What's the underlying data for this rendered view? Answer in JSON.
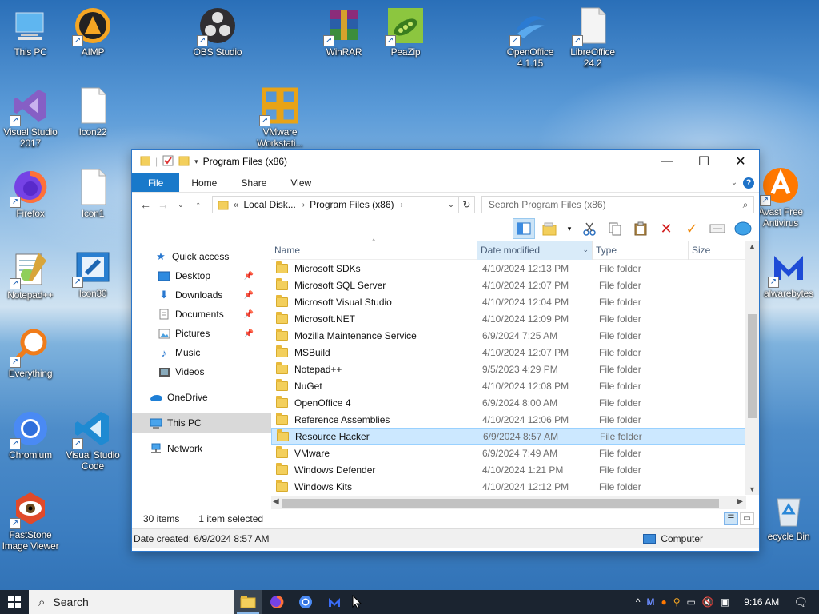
{
  "desktop": {
    "icons": [
      {
        "id": "this-pc",
        "label": "This PC"
      },
      {
        "id": "aimp",
        "label": "AIMP"
      },
      {
        "id": "obs",
        "label": "OBS Studio"
      },
      {
        "id": "winrar",
        "label": "WinRAR"
      },
      {
        "id": "peazip",
        "label": "PeaZip"
      },
      {
        "id": "openoffice",
        "label": "OpenOffice 4.1.15"
      },
      {
        "id": "libreoffice",
        "label": "LibreOffice 24.2"
      },
      {
        "id": "visualstudio",
        "label": "Visual Studio 2017"
      },
      {
        "id": "icon22",
        "label": "Icon22"
      },
      {
        "id": "vmware",
        "label": "VMware Workstati..."
      },
      {
        "id": "firefox",
        "label": "Firefox"
      },
      {
        "id": "icon1",
        "label": "Icon1"
      },
      {
        "id": "avast",
        "label": "Avast Free Antivirus"
      },
      {
        "id": "notepadpp",
        "label": "Notepad++"
      },
      {
        "id": "icon30",
        "label": "Icon30"
      },
      {
        "id": "malwarebytes",
        "label": "alwarebytes"
      },
      {
        "id": "everything",
        "label": "Everything"
      },
      {
        "id": "chromium",
        "label": "Chromium"
      },
      {
        "id": "vscode",
        "label": "Visual Studio Code"
      },
      {
        "id": "faststone",
        "label": "FastStone Image Viewer"
      },
      {
        "id": "recycle",
        "label": "ecycle Bin"
      }
    ]
  },
  "window": {
    "title": "Program Files (x86)",
    "minimize": "—",
    "maximize": "☐",
    "close": "✕"
  },
  "ribbon": {
    "tabs": [
      "File",
      "Home",
      "Share",
      "View"
    ],
    "expand": "⌄",
    "help": "?"
  },
  "address": {
    "back": "←",
    "forward": "→",
    "recent": "⌄",
    "up": "↑",
    "prefix": "«",
    "segments": [
      "Local Disk...",
      "Program Files (x86)"
    ],
    "chevron": "›",
    "dropdown": "⌄",
    "refresh": "↻"
  },
  "search": {
    "placeholder": "Search Program Files (x86)"
  },
  "nav": {
    "items": [
      {
        "label": "Quick access",
        "icon": "star-icon",
        "pinned": false
      },
      {
        "label": "Desktop",
        "icon": "desktop-icon",
        "pinned": true
      },
      {
        "label": "Downloads",
        "icon": "download-icon",
        "pinned": true
      },
      {
        "label": "Documents",
        "icon": "document-icon",
        "pinned": true
      },
      {
        "label": "Pictures",
        "icon": "picture-icon",
        "pinned": true
      },
      {
        "label": "Music",
        "icon": "music-icon",
        "pinned": false
      },
      {
        "label": "Videos",
        "icon": "video-icon",
        "pinned": false
      },
      {
        "label": "OneDrive",
        "icon": "cloud-icon",
        "pinned": false
      },
      {
        "label": "This PC",
        "icon": "computer-icon",
        "pinned": false
      },
      {
        "label": "Network",
        "icon": "network-icon",
        "pinned": false
      }
    ]
  },
  "columns": {
    "name": "Name",
    "date": "Date modified",
    "type": "Type",
    "size": "Size",
    "date_sort": "⌄"
  },
  "files": [
    {
      "name": "Microsoft SDKs",
      "date": "4/10/2024 12:13 PM",
      "type": "File folder"
    },
    {
      "name": "Microsoft SQL Server",
      "date": "4/10/2024 12:07 PM",
      "type": "File folder"
    },
    {
      "name": "Microsoft Visual Studio",
      "date": "4/10/2024 12:04 PM",
      "type": "File folder"
    },
    {
      "name": "Microsoft.NET",
      "date": "4/10/2024 12:09 PM",
      "type": "File folder"
    },
    {
      "name": "Mozilla Maintenance Service",
      "date": "6/9/2024 7:25 AM",
      "type": "File folder"
    },
    {
      "name": "MSBuild",
      "date": "4/10/2024 12:07 PM",
      "type": "File folder"
    },
    {
      "name": "Notepad++",
      "date": "9/5/2023 4:29 PM",
      "type": "File folder"
    },
    {
      "name": "NuGet",
      "date": "4/10/2024 12:08 PM",
      "type": "File folder"
    },
    {
      "name": "OpenOffice 4",
      "date": "6/9/2024 8:00 AM",
      "type": "File folder"
    },
    {
      "name": "Reference Assemblies",
      "date": "4/10/2024 12:06 PM",
      "type": "File folder"
    },
    {
      "name": "Resource Hacker",
      "date": "6/9/2024 8:57 AM",
      "type": "File folder",
      "selected": true
    },
    {
      "name": "VMware",
      "date": "6/9/2024 7:49 AM",
      "type": "File folder"
    },
    {
      "name": "Windows Defender",
      "date": "4/10/2024 1:21 PM",
      "type": "File folder"
    },
    {
      "name": "Windows Kits",
      "date": "4/10/2024 12:12 PM",
      "type": "File folder"
    }
  ],
  "status": {
    "count": "30 items",
    "selection": "1 item selected"
  },
  "details": {
    "created": "Date created: 6/9/2024 8:57 AM",
    "location": "Computer"
  },
  "taskbar": {
    "search": "Search",
    "time": "9:16 AM"
  }
}
